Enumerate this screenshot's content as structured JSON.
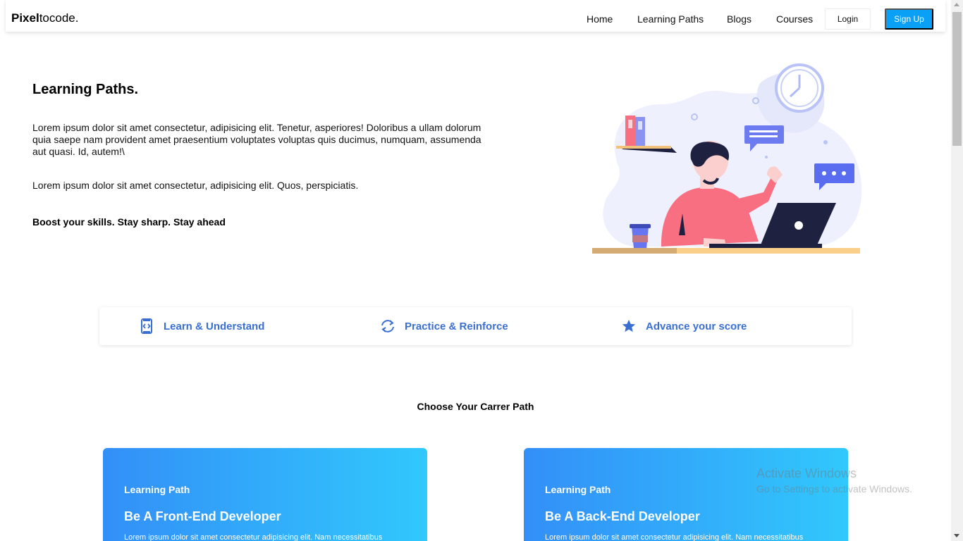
{
  "brand": {
    "bold": "Pixel",
    "rest": "tocode."
  },
  "nav": {
    "links": [
      "Home",
      "Learning Paths",
      "Blogs",
      "Courses"
    ],
    "login": "Login",
    "signup": "Sign Up"
  },
  "hero": {
    "title": "Learning Paths.",
    "para1": "Lorem ipsum dolor sit amet consectetur, adipisicing elit. Tenetur, asperiores! Doloribus a ullam dolorum quia saepe nam provident amet praesentium voluptates voluptas quis ducimus, numquam, assumenda aut quasi. Id, autem!\\",
    "para2": "Lorem ipsum dolor sit amet consectetur, adipisicing elit. Quos, perspiciatis.",
    "tagline": "Boost your skills. Stay sharp. Stay ahead"
  },
  "features": [
    {
      "label": "Learn & Understand",
      "icon": "code-file-icon"
    },
    {
      "label": "Practice & Reinforce",
      "icon": "refresh-icon"
    },
    {
      "label": "Advance your score",
      "icon": "star-icon"
    }
  ],
  "section_title": "Choose Your Carrer Path",
  "cards": [
    {
      "kicker": "Learning Path",
      "title": "Be A Front-End Developer",
      "desc": "Lorem ipsum dolor sit amet consectetur adipisicing elit. Nam necessitatibus"
    },
    {
      "kicker": "Learning Path",
      "title": "Be A Back-End Developer",
      "desc": "Lorem ipsum dolor sit amet consectetur adipisicing elit. Nam necessitatibus"
    }
  ],
  "watermark": {
    "line1": "Activate Windows",
    "line2": "Go to Settings to activate Windows."
  },
  "colors": {
    "accent": "#0aa0f5",
    "feature_text": "#3a6fd1",
    "card_from": "#338ff8",
    "card_to": "#31c8fc"
  }
}
